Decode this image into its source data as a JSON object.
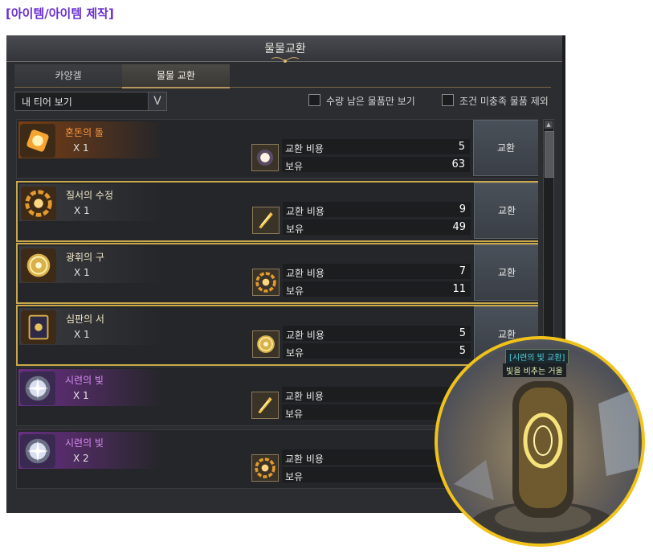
{
  "page_heading": "[아이템/아이템 제작]",
  "window": {
    "title": "물물교환"
  },
  "tabs": [
    {
      "label": "카양겔"
    },
    {
      "label": "물물 교환"
    }
  ],
  "filter": {
    "selected": "내 티어 보기",
    "toggle_symbol": "V"
  },
  "checkboxes": [
    {
      "label": "수량 남은 물품만 보기",
      "checked": false
    },
    {
      "label": "조건 미충족 물품 제외",
      "checked": false
    }
  ],
  "cost_label": "교환 비용",
  "own_label": "보유",
  "exchange_label": "교환",
  "items": [
    {
      "name": "혼돈의 돌",
      "qty": "X 1",
      "cost": "5",
      "owned": "63",
      "name_color": "#ff9a3c",
      "icon": "chaos-stone-icon",
      "cost_icon": "light-orb-icon",
      "selected": false
    },
    {
      "name": "질서의 수정",
      "qty": "X 1",
      "cost": "9",
      "owned": "49",
      "name_color": "#f0e6c8",
      "icon": "order-crystal-icon",
      "cost_icon": "golden-shard-icon",
      "selected": true
    },
    {
      "name": "광휘의 구",
      "qty": "X 1",
      "cost": "7",
      "owned": "11",
      "name_color": "#f0e6c8",
      "icon": "radiant-orb-icon",
      "cost_icon": "order-crystal-icon",
      "selected": true
    },
    {
      "name": "심판의 서",
      "qty": "X 1",
      "cost": "5",
      "owned": "5",
      "name_color": "#f0e6c8",
      "icon": "judgment-book-icon",
      "cost_icon": "radiant-orb-icon",
      "selected": true
    },
    {
      "name": "시련의 빛",
      "qty": "X 1",
      "cost": "",
      "owned": "",
      "name_color": "#d78cf0",
      "icon": "trial-light-icon",
      "cost_icon": "golden-shard-icon",
      "selected": false
    },
    {
      "name": "시련의 빛",
      "qty": "X 2",
      "cost": "",
      "owned": "",
      "name_color": "#d78cf0",
      "icon": "trial-light-icon",
      "cost_icon": "order-crystal-icon",
      "selected": false
    }
  ],
  "inset": {
    "caption_title": "[시련의 빛 교환]",
    "caption_sub": "빛을 비추는 거울"
  }
}
